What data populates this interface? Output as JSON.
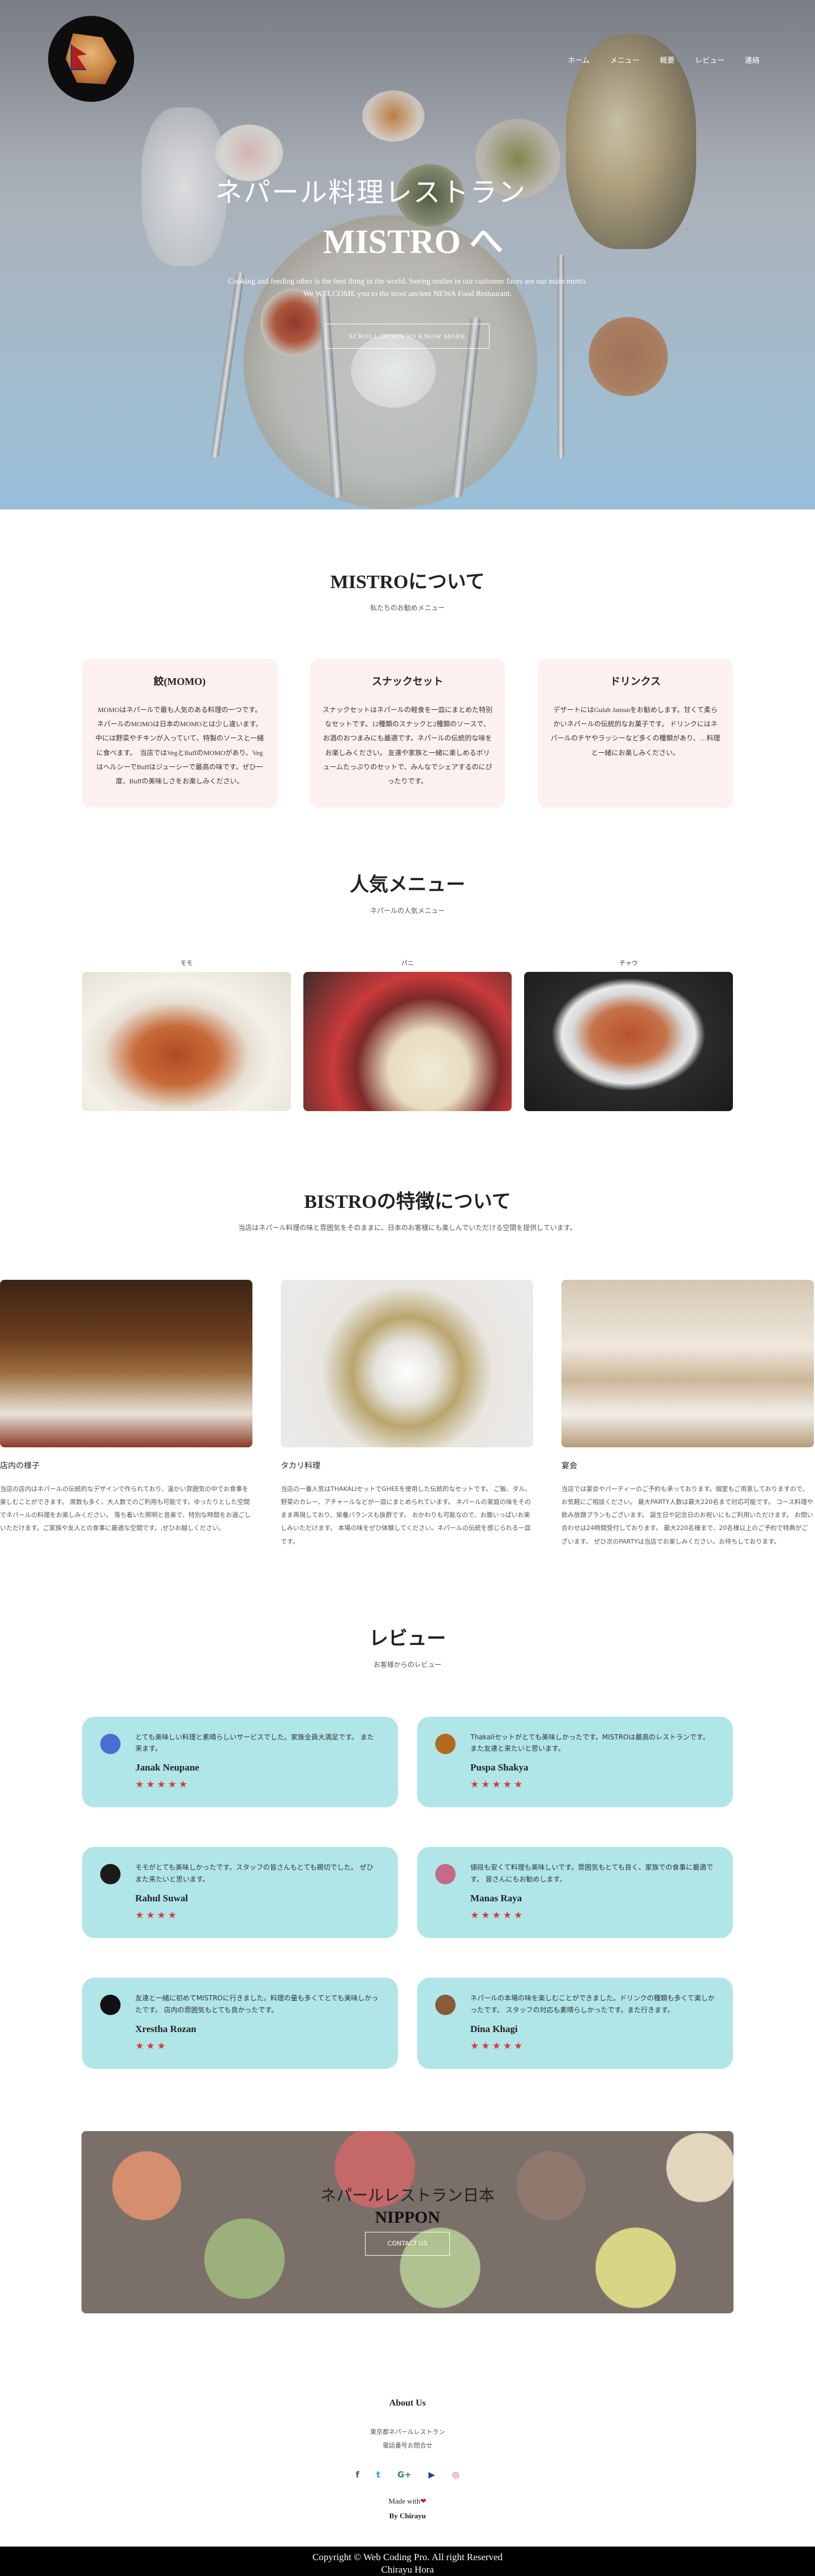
{
  "nav": {
    "items": [
      "ホーム",
      "メニュー",
      "概要",
      "レビュー",
      "連絡"
    ]
  },
  "hero": {
    "line1": "ネパール料理レストラン",
    "line2": "MISTRO へ",
    "subtitle1": "Cooking and feeding other is the best thing in the world. Seeing smiles in our customer faces are our main motto.",
    "subtitle2": "We WELCOME you to the most ancient NEWA Food Restaurant.",
    "button": "SCROLL DOWN TO KNOW MORE"
  },
  "about": {
    "title": "MISTROについて",
    "subtitle": "私たちのお勧めメニュー",
    "cards": [
      {
        "title": "餃(MOMO)",
        "text": "MOMOはネパールで最も人気のある料理の一つです。ネパールのMOMOは日本のMOMOとは少し違います。中には野菜やチキンが入っていて、特製のソースと一緒に食べます。　当店ではVegとBuffのMOMOがあり、VegはヘルシーでBuffはジューシーで最高の味です。ぜひ一度、Buffの美味しさをお楽しみください。"
      },
      {
        "title": "スナックセット",
        "text": "スナックセットはネパールの軽食を一皿にまとめた特別なセットです。12種類のスナックと2種類のソースで、お酒のおつまみにも最適です。ネパールの伝統的な味をお楽しみください。 友達や家族と一緒に楽しめるボリュームたっぷりのセットで、みんなでシェアするのにぴったりです。"
      },
      {
        "title": "ドリンクス",
        "text": "デザートにはGulab Jamunをお勧めします。甘くて柔らかいネパールの伝統的なお菓子です。 ドリンクにはネパールのチヤやラッシーなど多くの種類があり、…料理と一緒にお楽しみください。"
      }
    ]
  },
  "popular": {
    "title": "人気メニュー",
    "subtitle": "ネパールの人気メニュー",
    "dishes": [
      {
        "label": "モモ"
      },
      {
        "label": "パニ"
      },
      {
        "label": "チャウ"
      }
    ]
  },
  "bistro": {
    "title": "BISTROの特徴について",
    "subtitle": "当店はネパール料理の味と雰囲気をそのままに、日本のお客様にも楽しんでいただける空間を提供しています。",
    "columns": [
      {
        "heading": "店内の様子",
        "text": "当店の店内はネパールの伝統的なデザインで作られており、温かい雰囲気の中でお食事を楽しむことができます。 席数も多く、大人数でのご利用も可能です。ゆったりとした空間でネパールの料理をお楽しみください。 落ち着いた照明と音楽で、特別な時間をお過ごしいただけます。ご家族や友人との食事に最適な空間です。,ぜひお越しください。"
      },
      {
        "heading": "タカリ料理",
        "text": "当店の一番人気はTHAKALIセットでGHEEを使用した伝統的なセットです。 ご飯、ダル、野菜のカレー、アチャールなどが一皿にまとめられています。 ネパールの家庭の味をそのまま再現しており、栄養バランスも抜群です。 おかわりも可能なので、お腹いっぱいお楽しみいただけます。 本場の味をぜひ体験してください。ネパールの伝統を感じられる一皿です。"
      },
      {
        "heading": "宴会",
        "text": "当店では宴会やパーティーのご予約も承っております。個室もご用意しておりますので、お気軽にご相談ください。 最大PARTY人数は最大220名まで対応可能です。 コース料理や飲み放題プランもございます。 誕生日や記念日のお祝いにもご利用いただけます。 お問い合わせは24時間受付しております。 最大220名様まで、20名様以上のご予約で特典がございます。 ぜひ次のPARTYは当店でお楽しみください。お待ちしております。"
      }
    ]
  },
  "reviews": {
    "title": "レビュー",
    "subtitle": "お客様からのレビュー",
    "items": [
      {
        "quote": "とても美味しい料理と素晴らしいサービスでした。家族全員大満足です。 また来ます。",
        "name": "Janak Neupane",
        "stars": "★★★★★",
        "avatar_color": "#4a6fd1"
      },
      {
        "quote": "Thakaliセットがとても美味しかったです。MISTROは最高のレストランです。 また友達と来たいと思います。",
        "name": "Puspa Shakya",
        "stars": "★★★★★",
        "avatar_color": "#b36a1a"
      },
      {
        "quote": "モモがとても美味しかったです。スタッフの皆さんもとても親切でした。 ぜひまた来たいと思います。",
        "name": "Rahul Suwal",
        "stars": "★★★★",
        "avatar_color": "#1b1b1b"
      },
      {
        "quote": "値段も安くて料理も美味しいです。雰囲気もとても良く、家族での食事に最適です。 皆さんにもお勧めします。",
        "name": "Manas Raya",
        "stars": "★★★★★",
        "avatar_color": "#c56a8a"
      },
      {
        "quote": "友達と一緒に初めてMISTROに行きました。料理の量も多くてとても美味しかったです。 店内の雰囲気もとても良かったです。",
        "name": "Xrestha Rozan",
        "stars": "★★★",
        "avatar_color": "#111111"
      },
      {
        "quote": "ネパールの本場の味を楽しむことができました。ドリンクの種類も多くて楽しかったです。 スタッフの対応も素晴らしかったです。また行きます。",
        "name": "Dina Khagi",
        "stars": "★★★★★",
        "avatar_color": "#8a5a3a"
      }
    ]
  },
  "banner": {
    "line1": "ネパールレストラン日本",
    "line2": "NIPPON",
    "button": "CONTACT US"
  },
  "footer": {
    "title": "About Us",
    "info1": "東京都ネパールレストラン",
    "info2": "電話番号お問合せ",
    "socials": [
      "f",
      "t",
      "G+",
      "▶",
      "◎"
    ],
    "made_prefix": "Made with",
    "heart": "❤",
    "by": "By Chirayu",
    "copyright1": "Copyright © Web Coding Pro. All right Reserved",
    "copyright2": "Chirayu Hora"
  }
}
